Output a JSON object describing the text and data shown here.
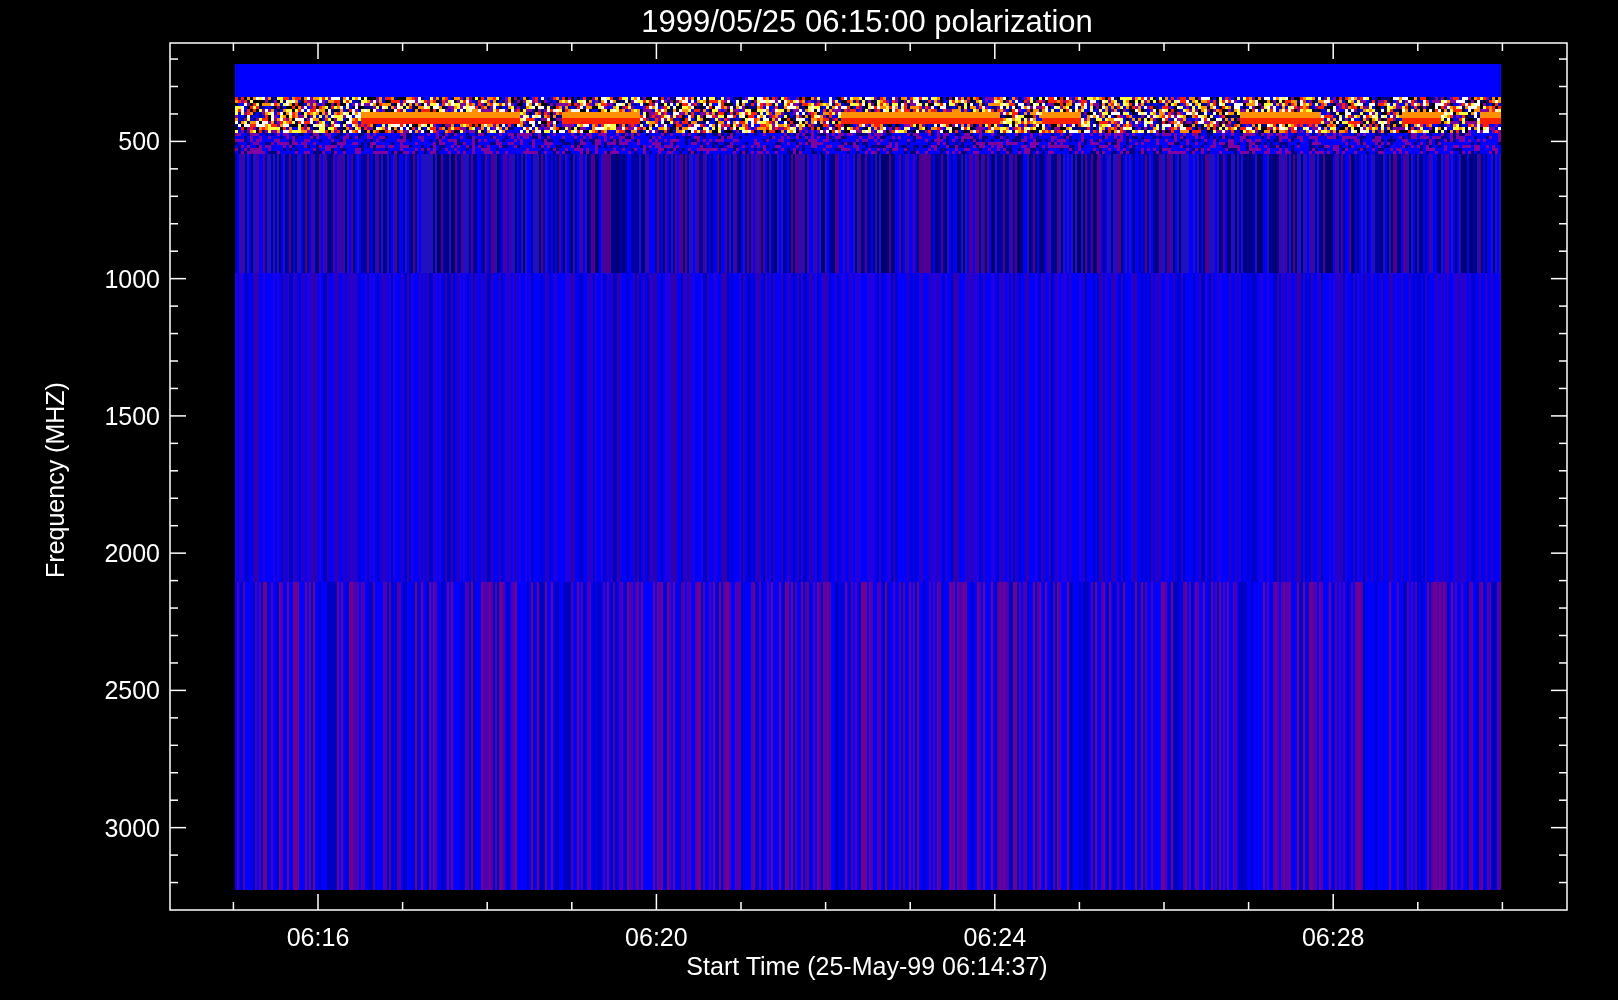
{
  "title": "1999/05/25 06:15:00 polarization",
  "x_axis": {
    "label": "Start Time (25-May-99 06:14:37)",
    "ticks": [
      "06:16",
      "06:20",
      "06:24",
      "06:28"
    ]
  },
  "y_axis": {
    "label": "Frequency (MHZ)",
    "ticks": [
      "500",
      "1000",
      "1500",
      "2000",
      "2500",
      "3000"
    ]
  }
}
